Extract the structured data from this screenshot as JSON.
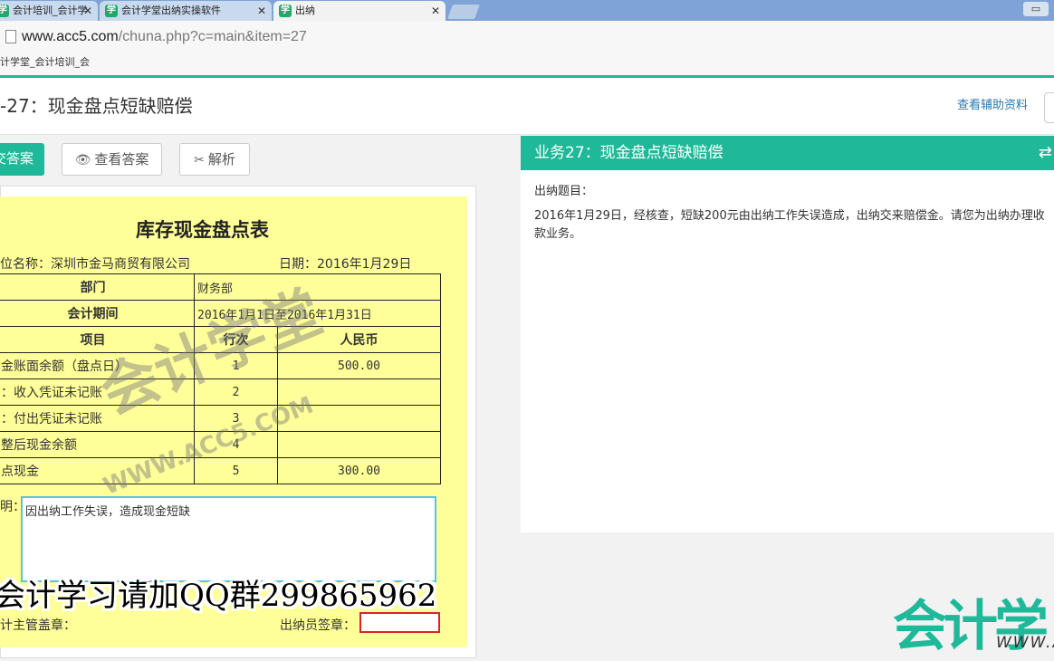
{
  "browser": {
    "tabs": [
      {
        "label": "会计培训_会计学",
        "active": false
      },
      {
        "label": "会计学堂出纳实操软件",
        "active": false
      },
      {
        "label": "出纳",
        "active": true
      }
    ],
    "tab_icon_glyph": "学",
    "close_glyph": "✕",
    "url_host": "www.acc5.com",
    "url_path": "/chuna.php?c=main&item=27",
    "bookmark": "计学堂_会计培训_会",
    "window_button": "▭"
  },
  "header": {
    "title": "-27：现金盘点短缺赔偿",
    "aux_link": "查看辅助资料"
  },
  "toolbar": {
    "submit_label": "交答案",
    "view_answer_label": "查看答案",
    "analysis_label": "解析",
    "eye_icon": "👁",
    "analysis_icon": "✂"
  },
  "form": {
    "title": "库存现金盘点表",
    "unit": "位名称：深圳市金马商贸有限公司",
    "date": "日期：2016年1月29日",
    "dept_label": "部门",
    "dept_value": "财务部",
    "period_label": "会计期间",
    "period_value": "2016年1月1日至2016年1月31日",
    "col_item": "项目",
    "col_line": "行次",
    "col_rmb": "人民币",
    "rows": [
      {
        "item": "金账面余额（盘点日）",
        "line": "1",
        "value": "500.00"
      },
      {
        "item": "：收入凭证未记账",
        "line": "2",
        "value": ""
      },
      {
        "item": "：付出凭证未记账",
        "line": "3",
        "value": ""
      },
      {
        "item": "整后现金余额",
        "line": "4",
        "value": ""
      },
      {
        "item": "点现金",
        "line": "5",
        "value": "300.00"
      }
    ],
    "note_label": "明：",
    "note_value": "因出纳工作失误，造成现金短缺",
    "sign_supervisor": "计主管盖章：",
    "sign_cashier": "出纳员签章："
  },
  "watermark": {
    "main": "会计学堂",
    "sub": "WWW.ACC5.COM"
  },
  "overlay_text": "会计学习请加QQ群299865962",
  "task_panel": {
    "title": "业务27：现金盘点短缺赔偿",
    "swap_icon": "⇄",
    "label": "出纳题目：",
    "text": "2016年1月29日，经核查，短缺200元由出纳工作失误造成，出纳交来赔偿金。请您为出纳办理收款业务。"
  },
  "logo": {
    "text": "会计学",
    "sub": "WWW.A"
  },
  "colors": {
    "accent": "#1fb99a",
    "form_bg": "#ffff99",
    "link": "#2a7ab0",
    "tabbar": "#7fa3d6"
  }
}
